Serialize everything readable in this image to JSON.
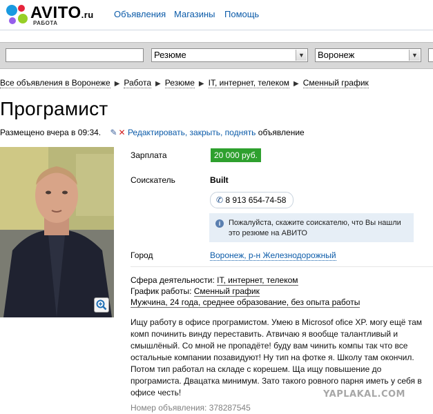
{
  "header": {
    "logo_text": "AVITO",
    "logo_suffix": ".ru",
    "logo_sub": "РАБОТА",
    "nav": [
      "Объявления",
      "Магазины",
      "Помощь"
    ]
  },
  "search": {
    "query_value": "",
    "category_value": "Резюме",
    "city_value": "Воронеж"
  },
  "breadcrumbs": [
    "Все объявления в Воронеже",
    "Работа",
    "Резюме",
    "IT, интернет, телеком",
    "Сменный график"
  ],
  "ad": {
    "title": "Програмист",
    "posted": "Размещено вчера в 09:34.",
    "edit_link": "Редактировать, закрыть, поднять",
    "edit_suffix": "объявление",
    "salary_label": "Зарплата",
    "salary_value": "20 000 руб.",
    "applicant_label": "Соискатель",
    "applicant_name": "Built",
    "phone": "8 913 654-74-58",
    "notice": "Пожалуйста, скажите соискателю, что Вы нашли это резюме на АВИТО",
    "city_label": "Город",
    "city_value": "Воронеж, р-н Железнодорожный",
    "sphere_label": "Сфера деятельности:",
    "sphere_value": "IT, интернет, телеком",
    "schedule_label": "График работы:",
    "schedule_value": "Сменный график",
    "personal": "Мужчина, 24 года, среднее образование, без опыта работы",
    "description": "Ищу работу в офисе програмистом. Умею в Microsof ofice XP. могу ещё там комп починить винду переставить. Атвичаю я вообще талантливый и смышлёный. Со мной не пропадёте! буду вам чинить компы так что все остальные компании позавидуют! Ну тип на фотке я. Школу там окончил. Потом тип работал на складе с корешем. Ща ищу повышение до програмиста. Двацатка минимум. Зато такого ровного парня иметь у себя в офисе честь!",
    "ad_number": "Номер объявления: 378287545"
  },
  "watermark": "YAPLAKAL.COM",
  "colors": {
    "link": "#0a5aa8",
    "salary_bg": "#2ea02e",
    "notice_bg": "#e6eef6",
    "delete": "#d21d1d"
  },
  "icons": [
    "avito-logo-icon",
    "chevron-down-icon",
    "pencil-icon",
    "close-icon",
    "phone-icon",
    "info-icon",
    "zoom-icon"
  ]
}
